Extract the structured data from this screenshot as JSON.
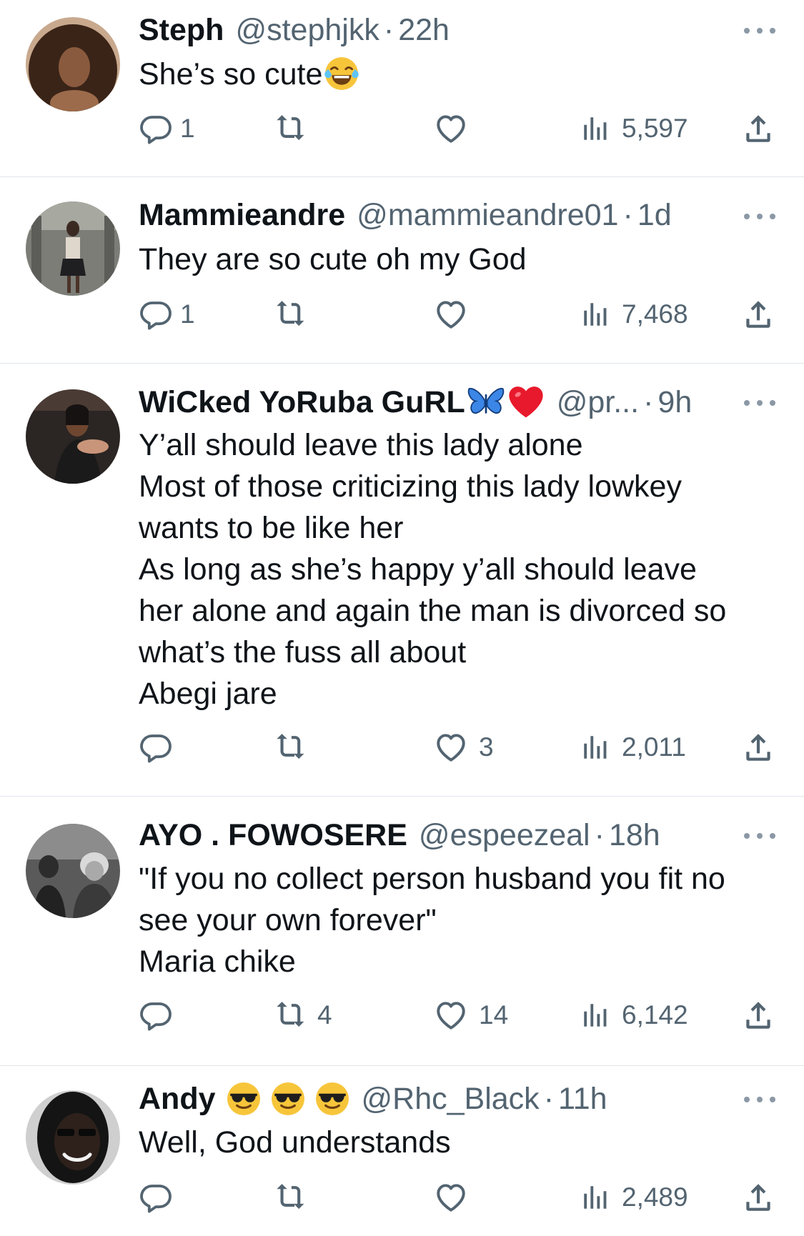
{
  "tweets": [
    {
      "name": "Steph",
      "handle": "@stephjkk",
      "time": "22h",
      "lines": [
        "She’s so cute"
      ],
      "name_emoji": [],
      "text_emoji": "face-with-tears-of-joy",
      "replies": "1",
      "retweets": "",
      "likes": "",
      "views": "5,597"
    },
    {
      "name": "Mammieandre",
      "handle": "@mammieandre01",
      "time": "1d",
      "lines": [
        "They are so cute oh my God"
      ],
      "replies": "1",
      "retweets": "",
      "likes": "",
      "views": "7,468"
    },
    {
      "name": "WiCked YoRuba GuRL",
      "handle": "@pr...",
      "time": "9h",
      "name_emoji": [
        "butterfly-emoji",
        "red-heart-emoji"
      ],
      "lines": [
        "Y’all should leave this lady alone",
        "Most of those criticizing this lady lowkey",
        "wants to be like her",
        "As long as she’s happy y’all should leave",
        "her alone and again the man is divorced so",
        "what’s the fuss all about",
        "Abegi jare"
      ],
      "replies": "",
      "retweets": "",
      "likes": "3",
      "views": "2,011"
    },
    {
      "name": "AYO . FOWOSERE",
      "handle": "@espeezeal",
      "time": "18h",
      "lines": [
        "\"If you no collect person husband you fit no",
        "see your own forever\"",
        "Maria chike"
      ],
      "replies": "",
      "retweets": "4",
      "likes": "14",
      "views": "6,142"
    },
    {
      "name": "Andy",
      "handle": "@Rhc_Black",
      "time": "11h",
      "name_emoji": [
        "sunglasses-emoji",
        "sunglasses-emoji",
        "sunglasses-emoji"
      ],
      "lines": [
        "Well, God understands"
      ],
      "replies": "",
      "retweets": "",
      "likes": "",
      "views": "2,489"
    }
  ],
  "separator": "·",
  "colors": {
    "text": "#0f1419",
    "secondary": "#536471",
    "divider": "#e1e5e9"
  }
}
